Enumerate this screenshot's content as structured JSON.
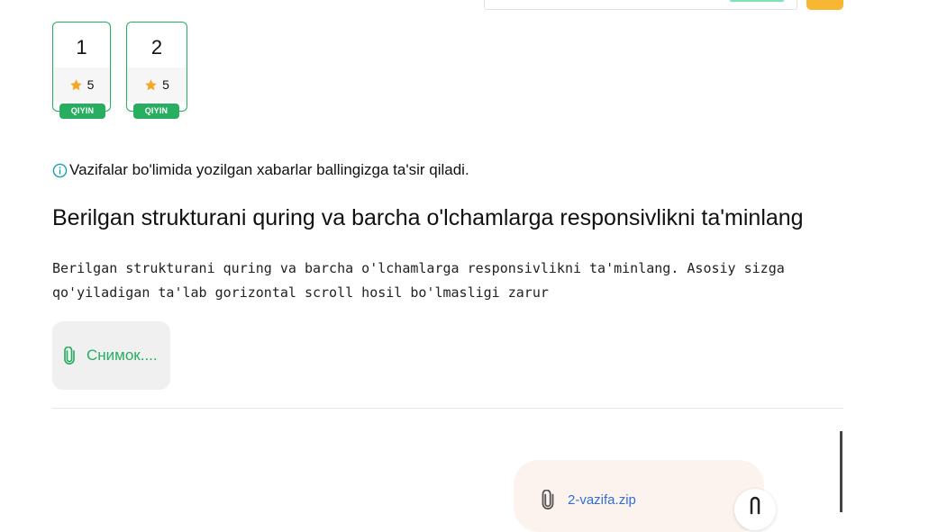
{
  "tasks": [
    {
      "number": "1",
      "rating": "5",
      "difficulty": "QIYIN"
    },
    {
      "number": "2",
      "rating": "5",
      "difficulty": "QIYIN"
    }
  ],
  "notice": {
    "text": "Vazifalar bo'limida yozilgan xabarlar ballingizga ta'sir qiladi.",
    "icon": "info-icon"
  },
  "task": {
    "title": "Berilgan strukturani quring va barcha o'lchamlarga responsivlikni ta'minlang",
    "description_line1": "Berilgan strukturani quring va barcha o'lchamlarga responsivlikni ta'minlang. Asosiy sizga",
    "description_line2": "qo'yiladigan ta'lab gorizontal scroll hosil bo'lmasligi zarur",
    "attachment": {
      "label": "Снимок....",
      "icon": "paperclip-icon"
    }
  },
  "message": {
    "file_name": "2-vazifa.zip",
    "icon": "paperclip-icon"
  },
  "colors": {
    "accent_green": "#27ae60",
    "star": "#f5a623",
    "link_blue": "#2f6fd6",
    "orange": "#f7b733"
  }
}
